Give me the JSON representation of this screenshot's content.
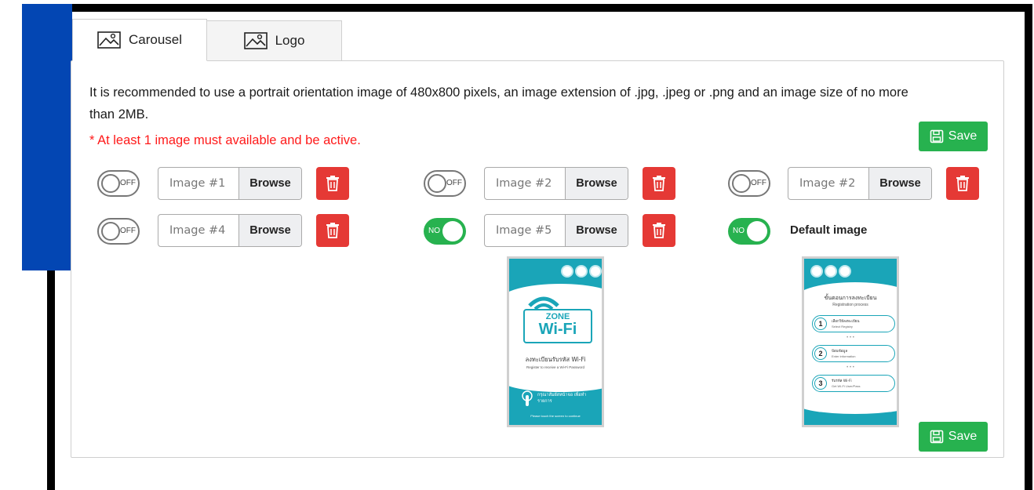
{
  "tabs": [
    {
      "label": "Carousel",
      "icon": "image-icon",
      "active": true
    },
    {
      "label": "Logo",
      "icon": "image-icon",
      "active": false
    }
  ],
  "description": "It is recommended to use a portrait orientation image of 480x800 pixels, an image extension of .jpg, .jpeg or .png and an image size of no more than 2MB.",
  "warning": "* At least 1 image must available and be active.",
  "save_label": "Save",
  "browse_label": "Browse",
  "toggle_off_label": "OFF",
  "toggle_on_label": "NO",
  "images": [
    {
      "name": "Image #1",
      "active": false
    },
    {
      "name": "Image #2",
      "active": false
    },
    {
      "name": "Image #2",
      "active": false
    },
    {
      "name": "Image #4",
      "active": false
    },
    {
      "name": "Image #5",
      "active": true
    }
  ],
  "default_image": {
    "label": "Default image",
    "active": true
  },
  "preview_wifi": {
    "zone": "ZONE",
    "wifi": "Wi-Fi",
    "th_title": "ลงทะเบียนรับรหัส Wi-Fi",
    "en_title": "Register to receive a Wi-Fi Password",
    "th_touch": "กรุณาสัมผัสหน้าจอ เพื่อทำรายการ",
    "en_touch": "Please touch the screen to continue"
  },
  "preview_default": {
    "th_title": "ขั้นตอนการลงทะเบียน",
    "en_title": "Registration process",
    "steps": [
      {
        "num": "1",
        "th": "เลือกวิธีลงทะเบียน",
        "en": "Select Registry"
      },
      {
        "num": "2",
        "th": "ป้อนข้อมูล",
        "en": "Enter information"
      },
      {
        "num": "3",
        "th": "รับรหัส Wi-Fi",
        "en": "Get Wi-Fi User/Pass"
      }
    ]
  },
  "colors": {
    "accent_green": "#27b24f",
    "delete_red": "#e53935",
    "warning_red": "#ff1a1a",
    "sidebar_blue": "#0346b3"
  }
}
